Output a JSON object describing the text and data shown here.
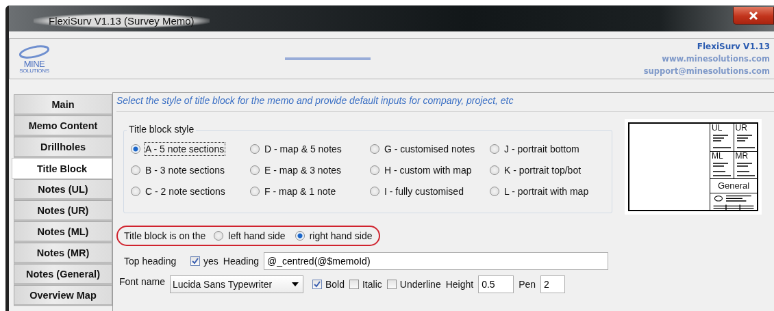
{
  "window": {
    "title": "FlexiSurv V1.13  (Survey Memo)"
  },
  "header": {
    "product": "FlexiSurv V1.13",
    "website": "www.minesolutions.com",
    "email": "support@minesolutions.com",
    "logo_text": "MINE",
    "logo_subtext": "SOLUTIONS"
  },
  "sidebar": {
    "items": [
      {
        "label": "Main",
        "selected": false
      },
      {
        "label": "Memo Content",
        "selected": false
      },
      {
        "label": "Drillholes",
        "selected": false
      },
      {
        "label": "Title Block",
        "selected": true
      },
      {
        "label": "Notes (UL)",
        "selected": false
      },
      {
        "label": "Notes (UR)",
        "selected": false
      },
      {
        "label": "Notes (ML)",
        "selected": false
      },
      {
        "label": "Notes (MR)",
        "selected": false
      },
      {
        "label": "Notes (General)",
        "selected": false
      },
      {
        "label": "Overview Map",
        "selected": false
      }
    ]
  },
  "description": "Select the style of title block for the memo and provide default inputs for company, project, etc",
  "title_block_style": {
    "label": "Title block style",
    "options": [
      {
        "label": "A - 5 note sections",
        "selected": true
      },
      {
        "label": "D - map & 5 notes",
        "selected": false
      },
      {
        "label": "G - customised notes",
        "selected": false
      },
      {
        "label": "J - portrait bottom",
        "selected": false
      },
      {
        "label": "B - 3 note sections",
        "selected": false
      },
      {
        "label": "E - map & 3 notes",
        "selected": false
      },
      {
        "label": "H - custom with map",
        "selected": false
      },
      {
        "label": "K - portrait top/bot",
        "selected": false
      },
      {
        "label": "C - 2 note sections",
        "selected": false
      },
      {
        "label": "F - map & 1 note",
        "selected": false
      },
      {
        "label": "I - fully customised",
        "selected": false
      },
      {
        "label": "L - portrait with map",
        "selected": false
      }
    ]
  },
  "preview": {
    "cells": [
      "UL",
      "UR",
      "ML",
      "MR"
    ],
    "general": "General"
  },
  "side": {
    "label": "Title block is on the",
    "options": [
      {
        "label": "left hand side",
        "selected": false
      },
      {
        "label": "right hand side",
        "selected": true
      }
    ]
  },
  "top_heading": {
    "label": "Top heading",
    "checkbox": {
      "label": "yes",
      "checked": true
    },
    "heading_label": "Heading",
    "heading_value": "@_centred(@$memoId)"
  },
  "font": {
    "label": "Font name",
    "value": "Lucida Sans Typewriter",
    "styles": [
      {
        "label": "Bold",
        "checked": true
      },
      {
        "label": "Italic",
        "checked": false
      },
      {
        "label": "Underline",
        "checked": false
      }
    ],
    "height_label": "Height",
    "height_value": "0.5",
    "pen_label": "Pen",
    "pen_value": "2"
  }
}
